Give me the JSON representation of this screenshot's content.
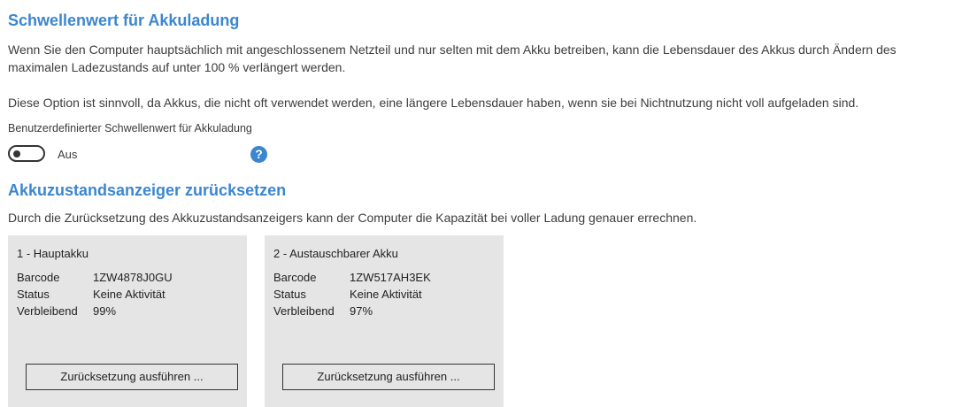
{
  "charge_threshold": {
    "title": "Schwellenwert für Akkuladung",
    "description": "Wenn Sie den Computer hauptsächlich mit angeschlossenem Netzteil und nur selten mit dem Akku betreiben, kann die Lebensdauer des Akkus durch Ändern des maximalen Ladezustands auf unter 100 % verlängert werden.",
    "note": "Diese Option ist sinnvoll, da Akkus, die nicht oft verwendet werden, eine längere Lebensdauer haben, wenn sie bei Nichtnutzung nicht voll aufgeladen sind.",
    "custom_label": "Benutzerdefinierter Schwellenwert für Akkuladung",
    "toggle_state": "Aus",
    "help_glyph": "?",
    "help_icon": "question-circle-icon"
  },
  "reset_gauge": {
    "title": "Akkuzustandsanzeiger zurücksetzen",
    "description": "Durch die Zurücksetzung des Akkuzustandsanzeigers kann der Computer die Kapazität bei voller Ladung genauer errechnen.",
    "batteries": [
      {
        "title": "1 - Hauptakku",
        "barcode_label": "Barcode",
        "barcode": "1ZW4878J0GU",
        "status_label": "Status",
        "status": "Keine Aktivität",
        "remaining_label": "Verbleibend",
        "remaining": "99%",
        "button": "Zurücksetzung ausführen ..."
      },
      {
        "title": "2 - Austauschbarer Akku",
        "barcode_label": "Barcode",
        "barcode": "1ZW517AH3EK",
        "status_label": "Status",
        "status": "Keine Aktivität",
        "remaining_label": "Verbleibend",
        "remaining": "97%",
        "button": "Zurücksetzung ausführen ..."
      }
    ]
  },
  "colors": {
    "accent": "#3b86cf",
    "card_background": "#e5e5e5",
    "text": "#3c3c3c"
  }
}
